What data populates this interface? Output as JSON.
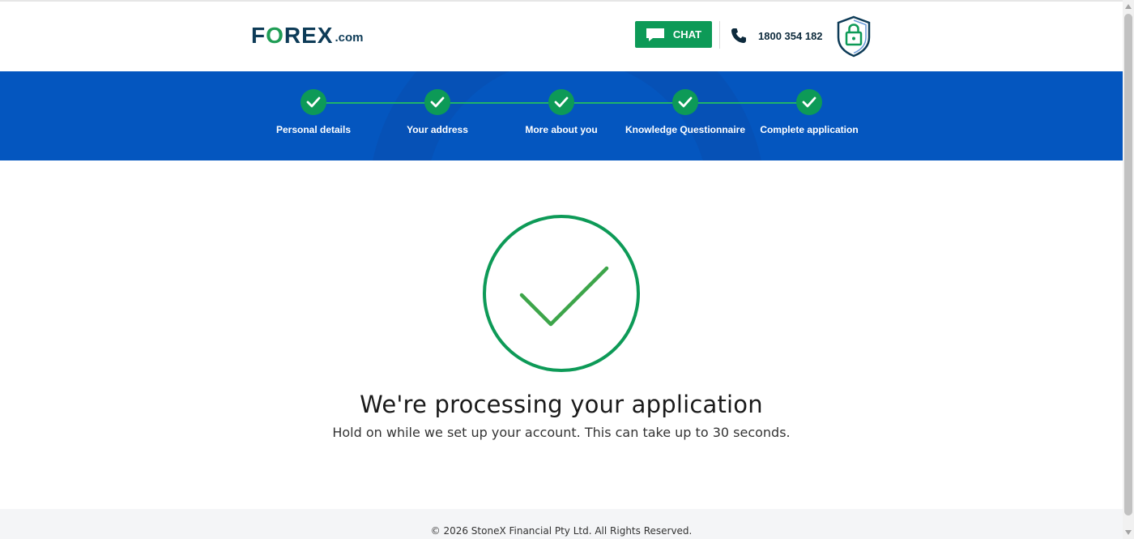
{
  "header": {
    "logo_main_pre": "F",
    "logo_main_o": "O",
    "logo_main_post": "REX",
    "logo_dotcom": ".com",
    "chat_label": "CHAT",
    "phone_number": "1800 354 182"
  },
  "progress": {
    "steps": [
      {
        "label": "Personal details",
        "status": "complete"
      },
      {
        "label": "Your address",
        "status": "complete"
      },
      {
        "label": "More about you",
        "status": "complete"
      },
      {
        "label": "Knowledge Questionnaire",
        "status": "complete"
      },
      {
        "label": "Complete application",
        "status": "complete"
      }
    ]
  },
  "main": {
    "title": "We're processing your application",
    "subtitle": "Hold on while we set up your account. This can take up to 30 seconds."
  },
  "footer": {
    "copyright": "© 2026 StoneX Financial Pty Ltd. All Rights Reserved."
  },
  "icons": {
    "chat": "chat-bubble-icon",
    "phone": "phone-icon",
    "security": "shield-lock-icon",
    "step": "check-icon",
    "success": "circle-check-icon"
  },
  "colors": {
    "brand_green": "#0d9a57",
    "brand_blue": "#0456bf",
    "logo_navy": "#0d3b57"
  }
}
